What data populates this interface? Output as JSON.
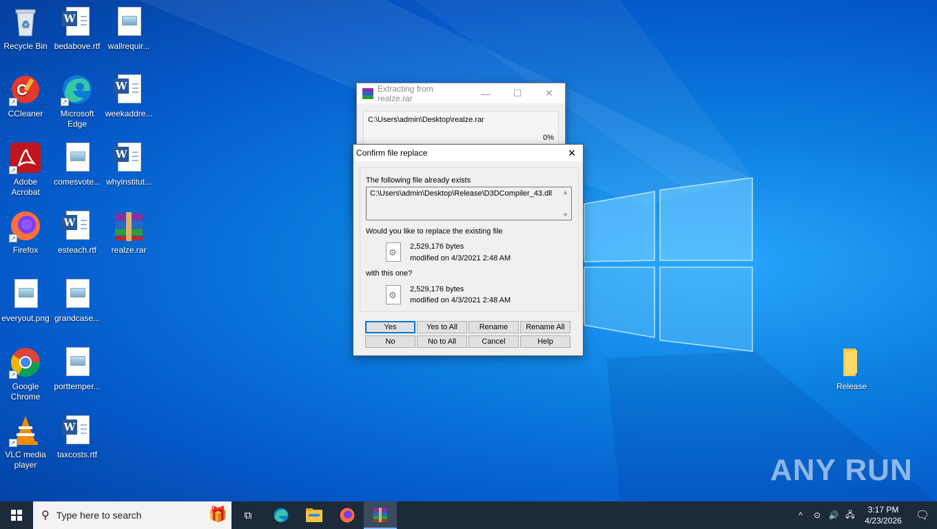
{
  "desktop": {
    "icons": [
      {
        "label": "Recycle Bin"
      },
      {
        "label": "bedabove.rtf"
      },
      {
        "label": "wallrequir..."
      },
      {
        "label": "CCleaner"
      },
      {
        "label": "Microsoft Edge"
      },
      {
        "label": "weekaddre..."
      },
      {
        "label": "Adobe Acrobat"
      },
      {
        "label": "comesvote..."
      },
      {
        "label": "whyinstitut..."
      },
      {
        "label": "Firefox"
      },
      {
        "label": "esteach.rtf"
      },
      {
        "label": "realze.rar"
      },
      {
        "label": "everyout.png"
      },
      {
        "label": "grandcase..."
      },
      {
        "label": "Google Chrome"
      },
      {
        "label": "porttemper..."
      },
      {
        "label": "VLC media player"
      },
      {
        "label": "taxcosts.rtf"
      },
      {
        "label": "Release"
      }
    ]
  },
  "extract_window": {
    "title": "Extracting from realze.rar",
    "path": "C:\\Users\\admin\\Desktop\\realze.rar",
    "percent": "0%"
  },
  "confirm_dialog": {
    "title": "Confirm file replace",
    "exists_label": "The following file already exists",
    "existing_path": "C:\\Users\\admin\\Desktop\\Release\\D3DCompiler_43.dll",
    "question": "Would you like to replace the existing file",
    "existing_size": "2,529,176 bytes",
    "existing_modified": "modified on 4/3/2021 2:48 AM",
    "with_label": "with this one?",
    "new_size": "2,529,176 bytes",
    "new_modified": "modified on 4/3/2021 2:48 AM",
    "buttons": {
      "yes": "Yes",
      "yes_to_all": "Yes to All",
      "rename": "Rename",
      "rename_all": "Rename All",
      "no": "No",
      "no_to_all": "No to All",
      "cancel": "Cancel",
      "help": "Help"
    }
  },
  "taskbar": {
    "search_placeholder": "Type here to search",
    "time": "3:17 PM",
    "date": "4/23/2026"
  },
  "watermark": "ANY RUN"
}
